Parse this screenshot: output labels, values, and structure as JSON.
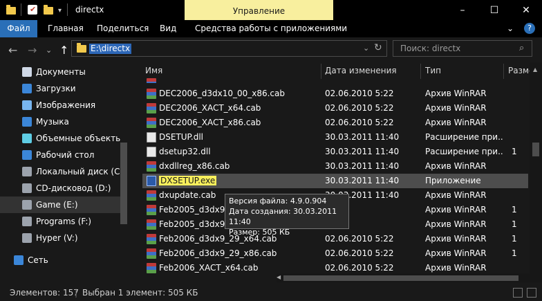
{
  "window": {
    "title": "directx",
    "manage_tab": "Управление",
    "controls": {
      "minimize": "–",
      "maximize": "☐",
      "close": "✕"
    }
  },
  "ribbon": {
    "tabs": [
      "Файл",
      "Главная",
      "Поделиться",
      "Вид",
      "Средства работы с приложениями"
    ],
    "expand": "⌄",
    "help": "?"
  },
  "address": {
    "path": "E:\\directx",
    "refresh": "↻",
    "search_placeholder": "Поиск: directx"
  },
  "nav": {
    "back": "←",
    "forward": "→",
    "up": "↑",
    "dropdown": "⌄"
  },
  "sidebar": {
    "items": [
      {
        "label": "Документы",
        "color": "#cfd8e6"
      },
      {
        "label": "Загрузки",
        "color": "#3b86d8"
      },
      {
        "label": "Изображения",
        "color": "#78b6f0"
      },
      {
        "label": "Музыка",
        "color": "#3b86d8"
      },
      {
        "label": "Объемные объекты",
        "color": "#5fcde4"
      },
      {
        "label": "Рабочий стол",
        "color": "#3b86d8"
      },
      {
        "label": "Локальный диск (C:)",
        "color": "#9ca3ad"
      },
      {
        "label": "CD-дисковод (D:)",
        "color": "#9ca3ad"
      },
      {
        "label": "Game (E:)",
        "color": "#9ca3ad"
      },
      {
        "label": "Programs (F:)",
        "color": "#9ca3ad"
      },
      {
        "label": "Hyper (V:)",
        "color": "#9ca3ad"
      },
      {
        "label": "Сеть",
        "color": "#3b86d8"
      }
    ]
  },
  "columns": [
    "Имя",
    "Дата изменения",
    "Тип",
    "Разме"
  ],
  "files": [
    {
      "name": "DEC2006_d3dx10_00_x64.cab",
      "date": "02.06.2010 5:22",
      "type": "Архив WinRAR",
      "size": "",
      "icon": "rar"
    },
    {
      "name": "DEC2006_d3dx10_00_x86.cab",
      "date": "02.06.2010 5:22",
      "type": "Архив WinRAR",
      "size": "",
      "icon": "rar"
    },
    {
      "name": "DEC2006_XACT_x64.cab",
      "date": "02.06.2010 5:22",
      "type": "Архив WinRAR",
      "size": "",
      "icon": "rar"
    },
    {
      "name": "DEC2006_XACT_x86.cab",
      "date": "02.06.2010 5:22",
      "type": "Архив WinRAR",
      "size": "",
      "icon": "rar"
    },
    {
      "name": "DSETUP.dll",
      "date": "30.03.2011 11:40",
      "type": "Расширение при...",
      "size": "",
      "icon": "dll"
    },
    {
      "name": "dsetup32.dll",
      "date": "30.03.2011 11:40",
      "type": "Расширение при...",
      "size": "1",
      "icon": "dll"
    },
    {
      "name": "dxdllreg_x86.cab",
      "date": "30.03.2011 11:40",
      "type": "Архив WinRAR",
      "size": "",
      "icon": "rar"
    },
    {
      "name": "DXSETUP.exe",
      "date": "30.03.2011 11:40",
      "type": "Приложение",
      "size": "",
      "icon": "exe",
      "selected": true
    },
    {
      "name": "dxupdate.cab",
      "date": "30.03.2011 11:40",
      "type": "Архив WinRAR",
      "size": "",
      "icon": "rar"
    },
    {
      "name": "Feb2005_d3dx9_24",
      "date": "",
      "type": "Архив WinRAR",
      "size": "1",
      "icon": "rar"
    },
    {
      "name": "Feb2005_d3dx9_24",
      "date": "",
      "type": "Архив WinRAR",
      "size": "1",
      "icon": "rar"
    },
    {
      "name": "Feb2006_d3dx9_29_x64.cab",
      "date": "02.06.2010 5:22",
      "type": "Архив WinRAR",
      "size": "1",
      "icon": "rar"
    },
    {
      "name": "Feb2006_d3dx9_29_x86.cab",
      "date": "02.06.2010 5:22",
      "type": "Архив WinRAR",
      "size": "1",
      "icon": "rar"
    },
    {
      "name": "Feb2006_XACT_x64.cab",
      "date": "02.06.2010 5:22",
      "type": "Архив WinRAR",
      "size": "",
      "icon": "rar"
    }
  ],
  "tooltip": {
    "version": "Версия файла: 4.9.0.904",
    "created": "Дата создания: 30.03.2011 11:40",
    "size": "Размер: 505 КБ"
  },
  "status": {
    "count": "Элементов: 157",
    "selected": "Выбран 1 элемент: 505 КБ"
  }
}
